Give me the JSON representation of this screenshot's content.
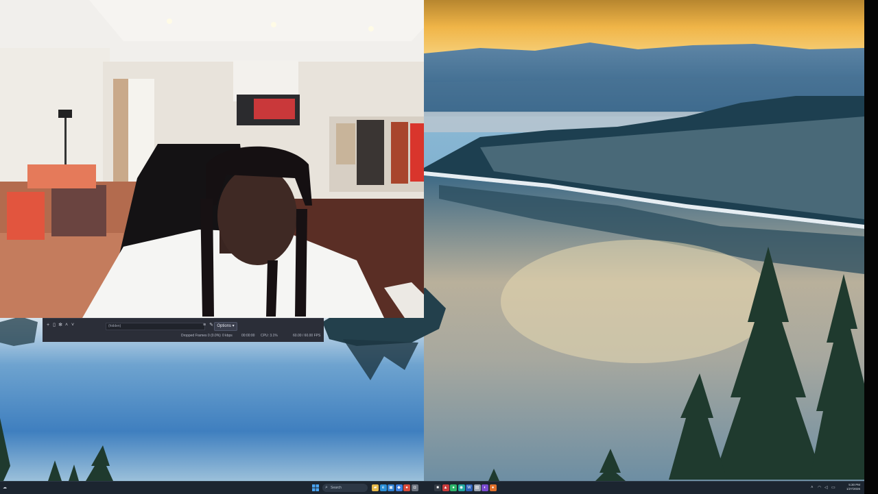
{
  "obs": {
    "field_placeholder": "(hidden)",
    "options_label": "Options",
    "stats": {
      "dropped_frames": "Dropped Frames 0 (0.0%)",
      "bitrate": "0 kbps",
      "rec_time": "00:00:00",
      "cpu": "CPU: 3.1%",
      "fps": "60.00 / 60.00 FPS"
    }
  },
  "taskbar": {
    "search_label": "Search",
    "clock_time": "5:30 PM",
    "clock_date": "1/27/2026",
    "apps": [
      {
        "name": "file-explorer",
        "glyph": "▰",
        "color": "#e6b94a"
      },
      {
        "name": "edge",
        "glyph": "e",
        "color": "#2a8fd6"
      },
      {
        "name": "store",
        "glyph": "▣",
        "color": "#2f7fd0"
      },
      {
        "name": "app-blue",
        "glyph": "◆",
        "color": "#3d7fe0"
      },
      {
        "name": "chrome",
        "glyph": "●",
        "color": "#d94a3a"
      },
      {
        "name": "app-grey",
        "glyph": "◘",
        "color": "#6d7480"
      },
      {
        "name": "app-dark",
        "glyph": "■",
        "color": "#333a44"
      },
      {
        "name": "app-red",
        "glyph": "▲",
        "color": "#c93b3b"
      },
      {
        "name": "app-green",
        "glyph": "●",
        "color": "#2fb46a"
      },
      {
        "name": "app-teal",
        "glyph": "◉",
        "color": "#21a7a0"
      },
      {
        "name": "word",
        "glyph": "W",
        "color": "#2b5fb8"
      },
      {
        "name": "app-light",
        "glyph": "▤",
        "color": "#9aa4b1"
      },
      {
        "name": "app-purple",
        "glyph": "◐",
        "color": "#7a4bd0"
      },
      {
        "name": "app-orange",
        "glyph": "●",
        "color": "#e0702b"
      }
    ]
  },
  "colors": {
    "taskbar_bg": "#1c2530",
    "obs_bg": "#2b2e38",
    "sky_gold": "#f1b547"
  }
}
